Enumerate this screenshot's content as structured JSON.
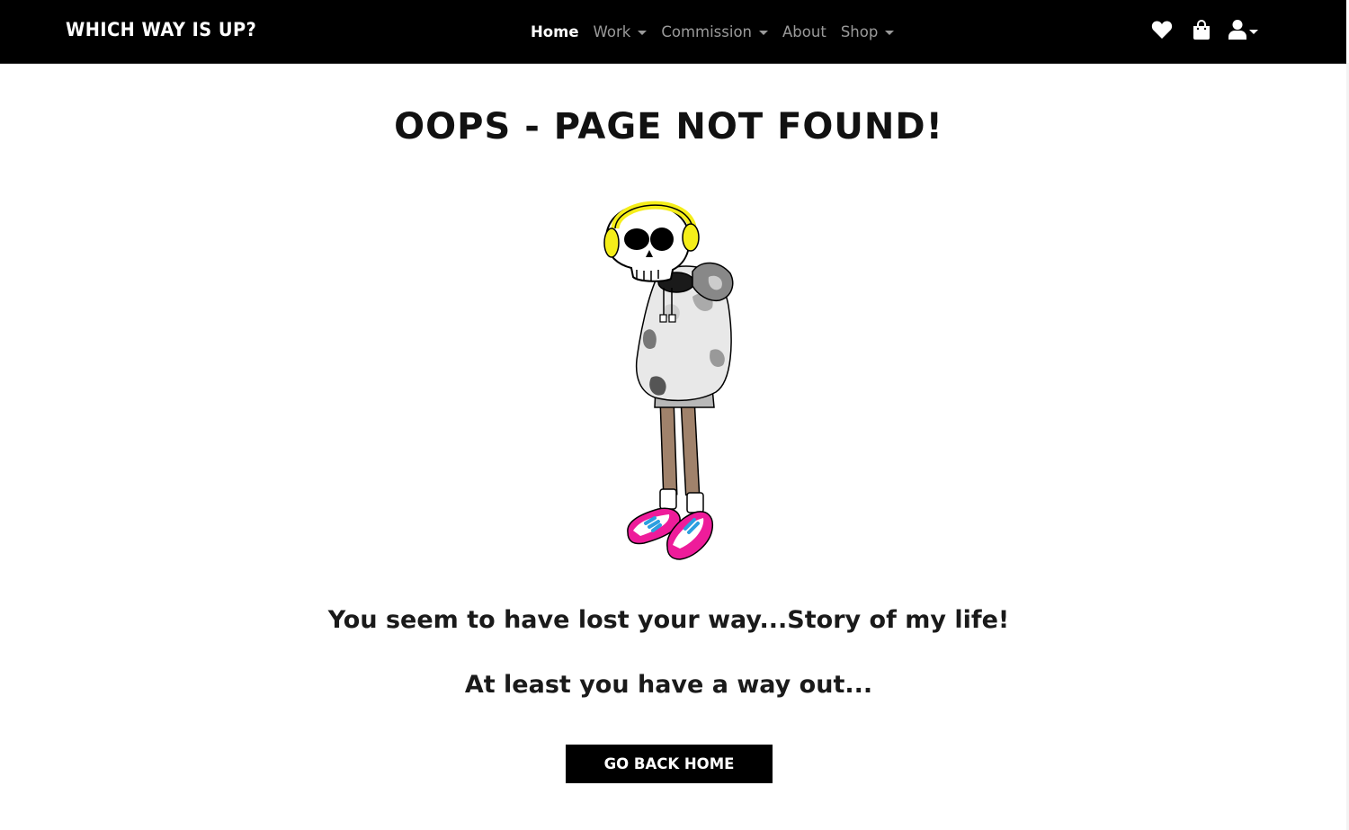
{
  "navbar": {
    "brand": "WHICH WAY IS UP?",
    "links": [
      {
        "label": "Home",
        "active": true,
        "dropdown": false
      },
      {
        "label": "Work",
        "active": false,
        "dropdown": true
      },
      {
        "label": "Commission",
        "active": false,
        "dropdown": true
      },
      {
        "label": "About",
        "active": false,
        "dropdown": false
      },
      {
        "label": "Shop",
        "active": false,
        "dropdown": true
      }
    ],
    "icons": [
      "heart-icon",
      "shopping-bag-icon",
      "user-icon"
    ]
  },
  "main": {
    "title": "OOPS - PAGE NOT FOUND!",
    "illustration": "skeleton-with-headphones",
    "message_1": "You seem to have lost your way...Story of my life!",
    "message_2": "At least you have a way out...",
    "button_label": "GO BACK HOME"
  },
  "colors": {
    "navbar_bg": "#000000",
    "nav_active": "#ffffff",
    "nav_inactive": "#9a9a9a",
    "button_bg": "#000000",
    "headphones": "#f5ee1a",
    "shoes": "#ee1c9a",
    "laces": "#2c9fe0",
    "legs": "#a0826b"
  }
}
